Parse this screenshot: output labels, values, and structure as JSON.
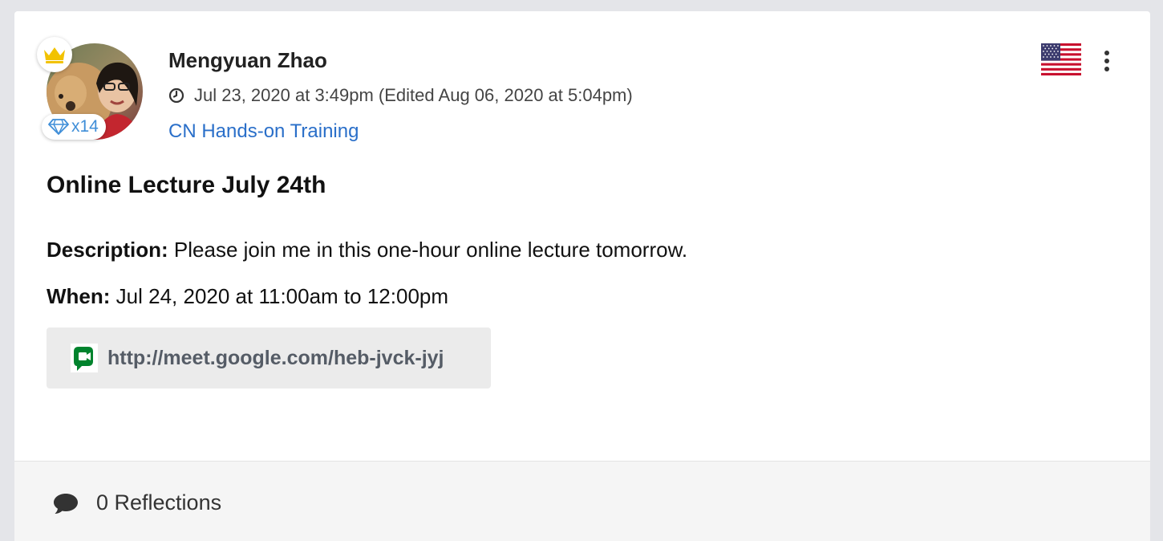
{
  "post": {
    "author": "Mengyuan Zhao",
    "timestamp": "Jul 23, 2020 at 3:49pm (Edited Aug 06, 2020 at 5:04pm)",
    "group": "CN Hands-on Training",
    "badge_count": "x14",
    "title": "Online Lecture July 24th",
    "description_label": "Description:",
    "description": "Please join me in this one-hour online lecture tomorrow.",
    "when_label": "When:",
    "when": "Jul 24, 2020 at 11:00am to 12:00pm",
    "meeting_url": "http://meet.google.com/heb-jvck-jyj"
  },
  "footer": {
    "reflections": "0 Reflections"
  },
  "icons": {
    "crown": "crown-icon",
    "badge": "diamond-icon",
    "clock": "clock-icon",
    "flag": "us-flag-icon",
    "menu": "more-vertical-icon",
    "meet": "google-meet-icon",
    "comment": "comment-icon"
  },
  "colors": {
    "link": "#2a6fc9",
    "crown": "#f2c200",
    "badge": "#3f8ed8",
    "meet_green": "#00832d"
  }
}
